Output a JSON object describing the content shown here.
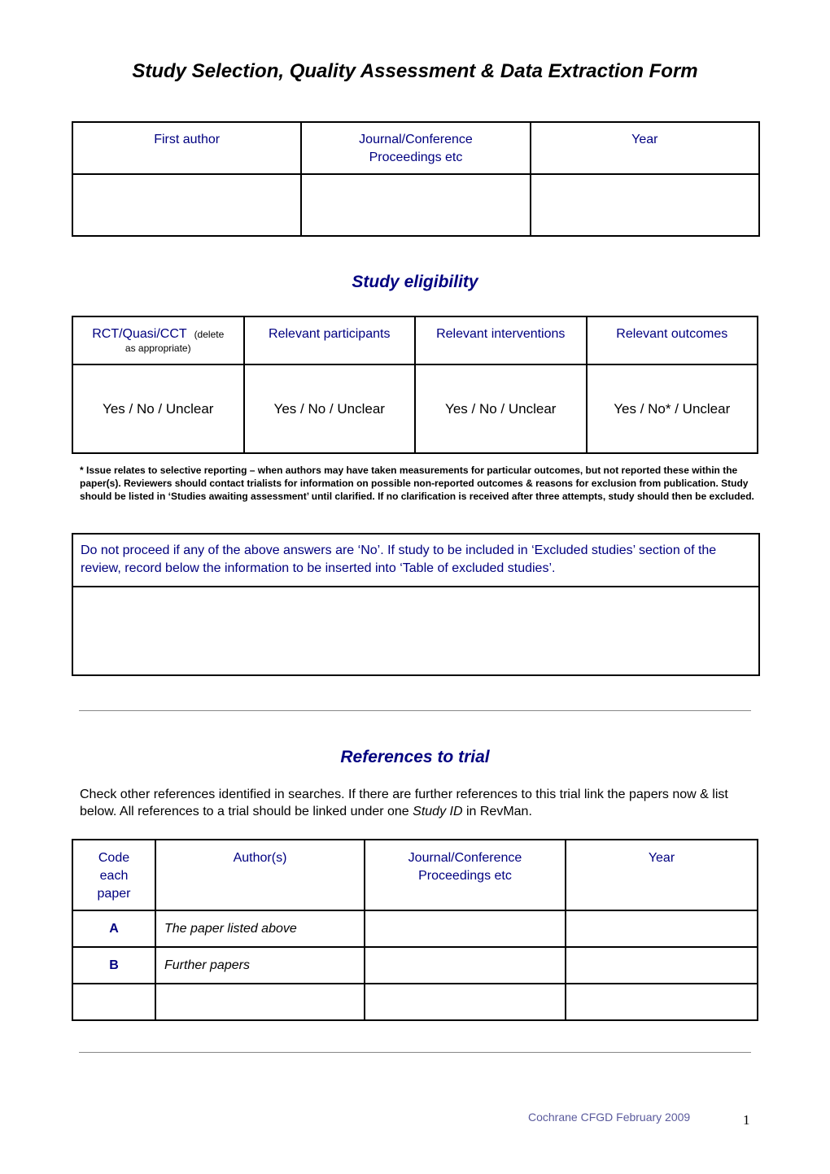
{
  "title": "Study Selection, Quality Assessment & Data Extraction Form",
  "study_table": {
    "headers": [
      "First author",
      "Journal/Conference Proceedings etc",
      "Year"
    ],
    "header_lines": [
      [
        "First author"
      ],
      [
        "Journal/Conference",
        "Proceedings etc"
      ],
      [
        "Year"
      ]
    ],
    "values": [
      "",
      "",
      ""
    ]
  },
  "eligibility": {
    "title": "Study eligibility",
    "headers": [
      {
        "label": "RCT/Quasi/CCT",
        "note_inline": "(delete",
        "note_below": "as appropriate)"
      },
      {
        "label": "Relevant participants"
      },
      {
        "label": "Relevant interventions"
      },
      {
        "label": "Relevant outcomes"
      }
    ],
    "answers": [
      "Yes / No / Unclear",
      "Yes / No / Unclear",
      "Yes / No / Unclear",
      "Yes / No* / Unclear"
    ],
    "footnote": "* Issue relates to selective reporting – when authors may have taken measurements for particular outcomes, but not reported these within the paper(s). Reviewers should contact trialists for information on possible non-reported outcomes & reasons for exclusion from publication. Study should be listed in ‘Studies awaiting assessment’ until clarified. If no clarification is received after three attempts, study should then be excluded."
  },
  "exclusion": {
    "note": "Do not proceed if any of the above answers are ‘No’. If study to be included in ‘Excluded studies’ section of the review, record below the information to be inserted into ‘Table of excluded studies’.",
    "value": ""
  },
  "references": {
    "title": "References to trial",
    "intro_before": "Check other references identified in searches. If there are further references to this trial link the papers now & list below. All references to a trial should be linked under one ",
    "intro_italic": "Study ID",
    "intro_after": " in RevMan.",
    "headers": [
      "Code each paper",
      "Author(s)",
      "Journal/Conference Proceedings etc",
      "Year"
    ],
    "header_lines": [
      [
        "Code",
        "each",
        "paper"
      ],
      [
        "Author(s)"
      ],
      [
        "Journal/Conference",
        "Proceedings etc"
      ],
      [
        "Year"
      ]
    ],
    "rows": [
      {
        "code": "A",
        "authors": "The paper listed above",
        "journal": "",
        "year": ""
      },
      {
        "code": "B",
        "authors": "Further papers",
        "journal": "",
        "year": ""
      },
      {
        "code": "",
        "authors": "",
        "journal": "",
        "year": ""
      }
    ]
  },
  "footer": {
    "text": "Cochrane CFGD February 2009",
    "page_number": "1"
  }
}
